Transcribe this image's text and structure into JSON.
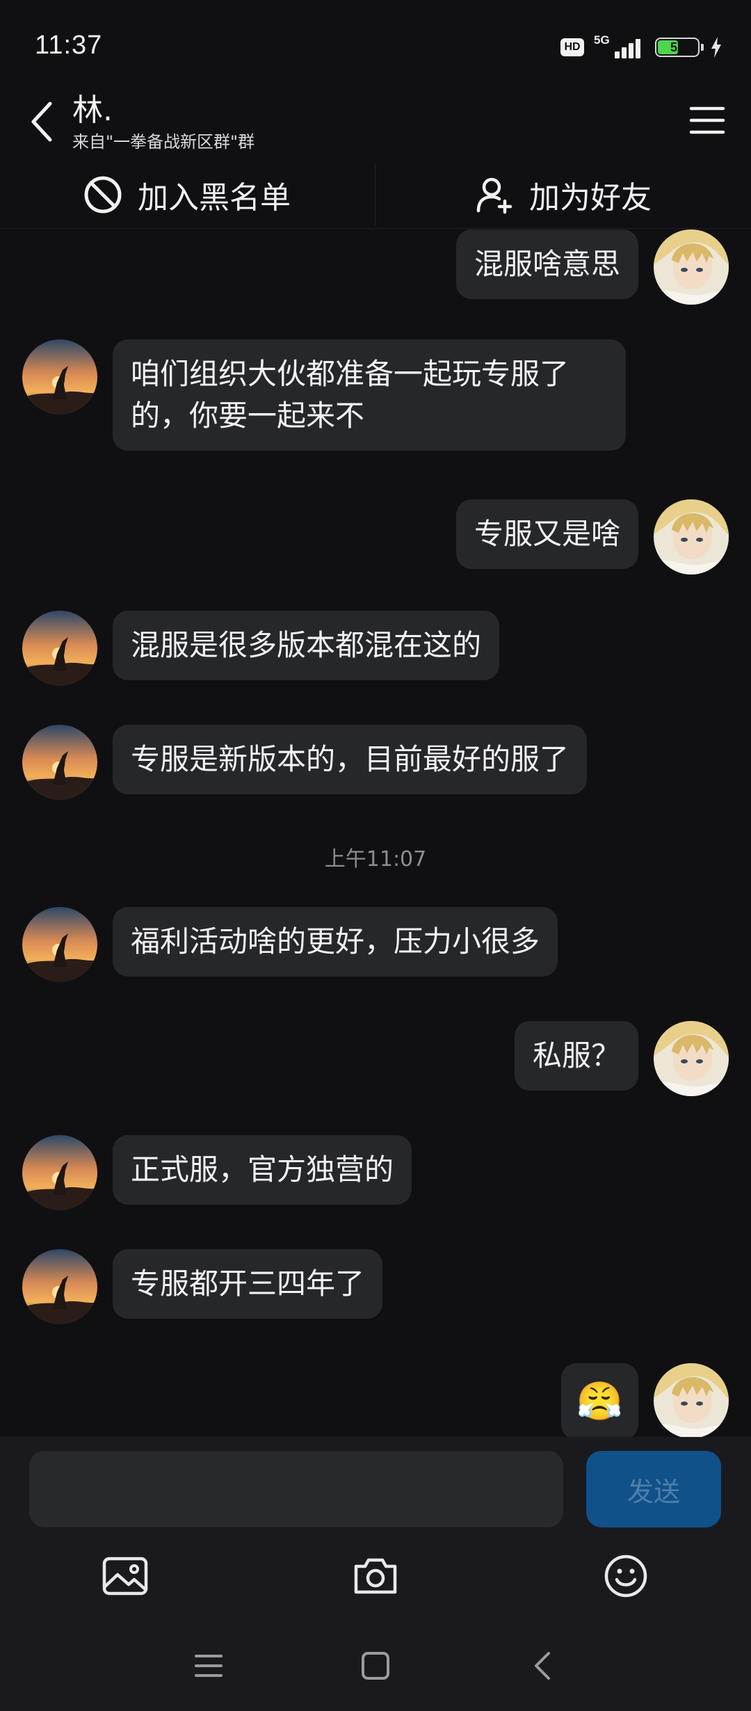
{
  "status_bar": {
    "time": "11:37",
    "hd_label": "HD",
    "network_label": "5G",
    "battery_level": "52",
    "battery_fill": 0.52,
    "charging": true
  },
  "header": {
    "title": "林.",
    "subtitle": "来自\"一拳备战新区群\"群"
  },
  "actions": {
    "block_label": "加入黑名单",
    "add_friend_label": "加为好友"
  },
  "messages": [
    {
      "direction": "out",
      "text": "混服啥意思"
    },
    {
      "direction": "in",
      "text": "咱们组织大伙都准备一起玩专服了的，你要一起来不"
    },
    {
      "direction": "out",
      "text": "专服又是啥"
    },
    {
      "direction": "in",
      "text": "混服是很多版本都混在这的"
    },
    {
      "direction": "in",
      "text": "专服是新版本的，目前最好的服了"
    },
    {
      "direction": "in",
      "text": "福利活动啥的更好，压力小很多"
    },
    {
      "direction": "out",
      "text": "私服？"
    },
    {
      "direction": "in",
      "text": "正式服，官方独营的"
    },
    {
      "direction": "in",
      "text": "专服都开三四年了"
    },
    {
      "direction": "out",
      "emoji": "😤"
    }
  ],
  "timestamp": "上午11:07",
  "composer": {
    "input_value": "",
    "send_label": "发送"
  },
  "icons": {
    "back": "back-arrow-icon",
    "menu": "hamburger-menu-icon",
    "block": "block-icon",
    "add_friend": "add-user-icon",
    "image": "image-icon",
    "camera": "camera-icon",
    "emoji": "smile-icon"
  },
  "colors": {
    "background": "#101012",
    "bubble": "#26272b",
    "send_button": "#10518a",
    "send_text": "#4f7fa9",
    "battery_fill": "#4dd54d"
  }
}
